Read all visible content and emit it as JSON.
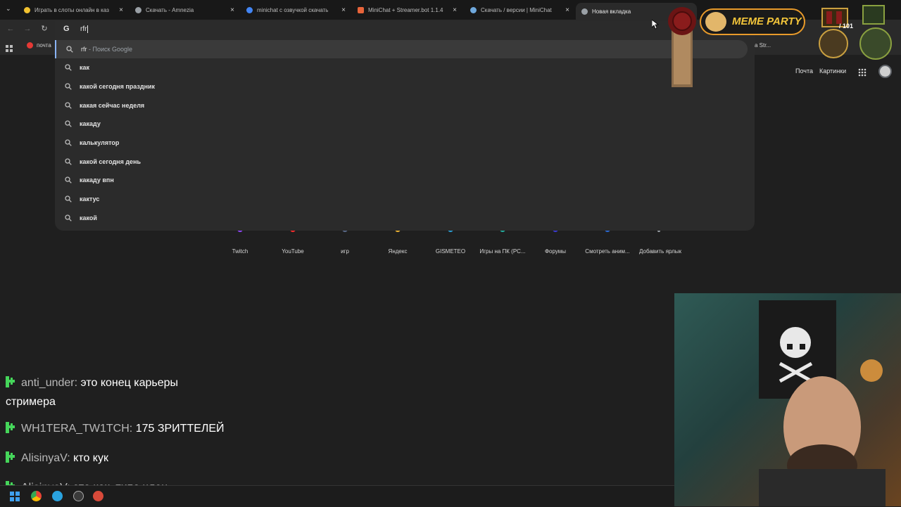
{
  "tabs": [
    {
      "title": "Играть в слоты онлайн в каз",
      "color": "#f2c230"
    },
    {
      "title": "Скачать - Amnezia",
      "color": "#9aa0a6"
    },
    {
      "title": "minichat с озвучкой скачать",
      "color": "#4285f4"
    },
    {
      "title": "MiniChat + Streamer.bot 1.1.4",
      "color": "#e8643a"
    },
    {
      "title": "Скачать / версии | MiniChat",
      "color": "#6fa8dc"
    },
    {
      "title": "Новая вкладка",
      "color": "#9aa0a6"
    }
  ],
  "tab_close_glyph": "×",
  "toolbar": {
    "back_icon": "back-arrow-icon",
    "forward_icon": "forward-arrow-icon",
    "reload_icon": "reload-icon"
  },
  "bookmarks": {
    "mail_label": "почта",
    "right_partial": "а Str..."
  },
  "omnibox": {
    "g_glyph": "G",
    "input_value": "rfr",
    "first_suggestion": {
      "query": "rfr",
      "suffix": " - Поиск Google"
    },
    "suggestions": [
      "как",
      "какой сегодня праздник",
      "какая сейчас неделя",
      "какаду",
      "калькулятор",
      "какой сегодня день",
      "какаду впн",
      "кактус",
      "какой"
    ]
  },
  "google_header": {
    "mail": "Почта",
    "images": "Картинки"
  },
  "shortcuts": [
    {
      "label": "Twitch",
      "color": "#9146ff"
    },
    {
      "label": "YouTube",
      "color": "#ff2b2b"
    },
    {
      "label": "игр",
      "color": "#5a6a8a"
    },
    {
      "label": "Яндекс",
      "color": "#f2b632"
    },
    {
      "label": "GISMETEO",
      "color": "#2aa0d8"
    },
    {
      "label": "Игры на ПК (PC...",
      "color": "#22b0a0"
    },
    {
      "label": "Форумы",
      "color": "#3a3ad8"
    },
    {
      "label": "Смотреть аним...",
      "color": "#2a6ad8"
    },
    {
      "label": "Добавить ярлык",
      "color": "#9aa0a6"
    }
  ],
  "overlay": {
    "meme_party": "MEME PARTY",
    "counter": "/ 101"
  },
  "chat": [
    {
      "user": "anti_under:",
      "message": "это конец карьеры"
    },
    {
      "continuation": "стримера"
    },
    {
      "user": "WH1TERA_TW1TCH:",
      "message": "175 ЗРИТТЕЛЕЙ"
    },
    {
      "user": "AlisinyaV:",
      "message": "кто кук"
    },
    {
      "user": "AlisinyaV:",
      "message": "это кок, типа член"
    }
  ],
  "colors": {
    "chat_badge": "#45d65a",
    "accent": "#8ab4f8",
    "overlay_border": "#e89a2a"
  }
}
